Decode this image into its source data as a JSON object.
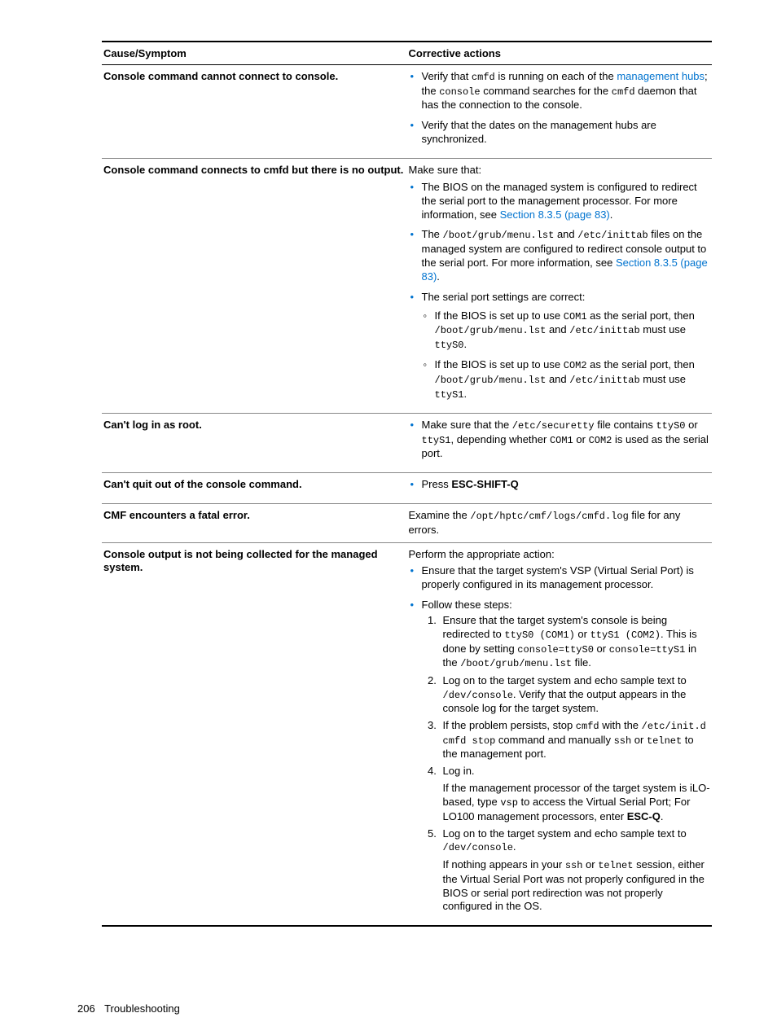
{
  "header": {
    "col1": "Cause/Symptom",
    "col2": "Corrective actions"
  },
  "rows": {
    "r1": {
      "cause": "Console command cannot connect to console.",
      "b1a": "Verify that ",
      "b1code": "cmfd",
      "b1b": " is running on each of the ",
      "b1link": "management hubs",
      "b1c": "; the ",
      "b1code2": "console",
      "b1d": " command searches for the ",
      "b1code3": "cmfd",
      "b1e": " daemon that has the connection to the console.",
      "b2": "Verify that the dates on the management hubs are synchronized."
    },
    "r2": {
      "cause": "Console command connects to cmfd but there is no output.",
      "intro": "Make sure that:",
      "b1a": "The BIOS on the managed system is configured to redirect the serial port to the management processor. For more information, see ",
      "b1link": "Section 8.3.5 (page 83)",
      "b1b": ".",
      "b2a": "The ",
      "b2c1": "/boot/grub/menu.lst",
      "b2b": " and ",
      "b2c2": "/etc/inittab",
      "b2c": " files on the managed system are configured to redirect console output to the serial port. For more information, see ",
      "b2link": "Section 8.3.5 (page 83)",
      "b2d": ".",
      "b3": "The serial port settings are correct:",
      "s1a": "If the BIOS is set up to use ",
      "s1c1": "COM1",
      "s1b": " as the serial port, then ",
      "s1c2": "/boot/grub/menu.lst",
      "s1c": " and ",
      "s1c3": "/etc/inittab",
      "s1d": " must use ",
      "s1c4": "ttyS0",
      "s1e": ".",
      "s2a": "If the BIOS is set up to use ",
      "s2c1": "COM2",
      "s2b": " as the serial port, then ",
      "s2c2": "/boot/grub/menu.lst",
      "s2c": " and ",
      "s2c3": "/etc/inittab",
      "s2d": " must use ",
      "s2c4": "ttyS1",
      "s2e": "."
    },
    "r3": {
      "cause": "Can't log in as root.",
      "b1a": "Make sure that the ",
      "b1c1": "/etc/securetty",
      "b1b": " file contains ",
      "b1c2": "ttyS0",
      "b1c": " or ",
      "b1c3": "ttyS1",
      "b1d": ", depending whether ",
      "b1c4": "COM1",
      "b1e": " or ",
      "b1c5": "COM2",
      "b1f": " is used as the serial port."
    },
    "r4": {
      "cause": "Can't quit out of the console command.",
      "b1a": "Press ",
      "b1bold": "ESC-SHIFT-Q"
    },
    "r5": {
      "cause": "CMF encounters a fatal error.",
      "txt_a": "Examine the ",
      "txt_code": "/opt/hptc/cmf/logs/cmfd.log",
      "txt_b": " file for any errors."
    },
    "r6": {
      "cause": "Console output is not being collected for the managed system.",
      "intro": "Perform the appropriate action:",
      "b1": "Ensure that the target system's VSP (Virtual Serial Port) is properly configured in its management processor.",
      "b2": "Follow these steps:",
      "step1a": "Ensure that the target system's console is being redirected to ",
      "step1c1": "ttyS0 (COM1)",
      "step1b": " or ",
      "step1c2": "ttyS1 (COM2)",
      "step1c": ". This is done by setting ",
      "step1c3": "console=ttyS0",
      "step1d": " or ",
      "step1c4": "console=ttyS1",
      "step1e": " in the ",
      "step1c5": "/boot/grub/menu.lst",
      "step1f": " file.",
      "step2a": "Log on to the target system and echo sample text to ",
      "step2c1": "/dev/console",
      "step2b": ". Verify that the output appears in the console log for the target system.",
      "step3a": "If the problem persists, stop ",
      "step3c1": "cmfd",
      "step3b": " with the ",
      "step3c2": "/etc/init.d cmfd stop",
      "step3c": " command and manually ",
      "step3c3": "ssh",
      "step3d": " or ",
      "step3c4": "telnet",
      "step3e": " to the management port.",
      "step4": "Log in.",
      "step4pa": "If the management processor of the target system is iLO-based, type ",
      "step4pc1": "vsp",
      "step4pb": " to access the Virtual Serial Port; For LO100 management processors, enter ",
      "step4pbold": "ESC-Q",
      "step4pc": ".",
      "step5a": "Log on to the target system and echo sample text to ",
      "step5c1": "/dev/console",
      "step5b": ".",
      "step5pa": "If nothing appears in your ",
      "step5pc1": "ssh",
      "step5pb": " or ",
      "step5pc2": "telnet",
      "step5pc": " session, either the Virtual Serial Port was not properly configured in the BIOS or serial port redirection was not properly configured in the OS."
    }
  },
  "footer": {
    "page": "206",
    "section": "Troubleshooting"
  }
}
